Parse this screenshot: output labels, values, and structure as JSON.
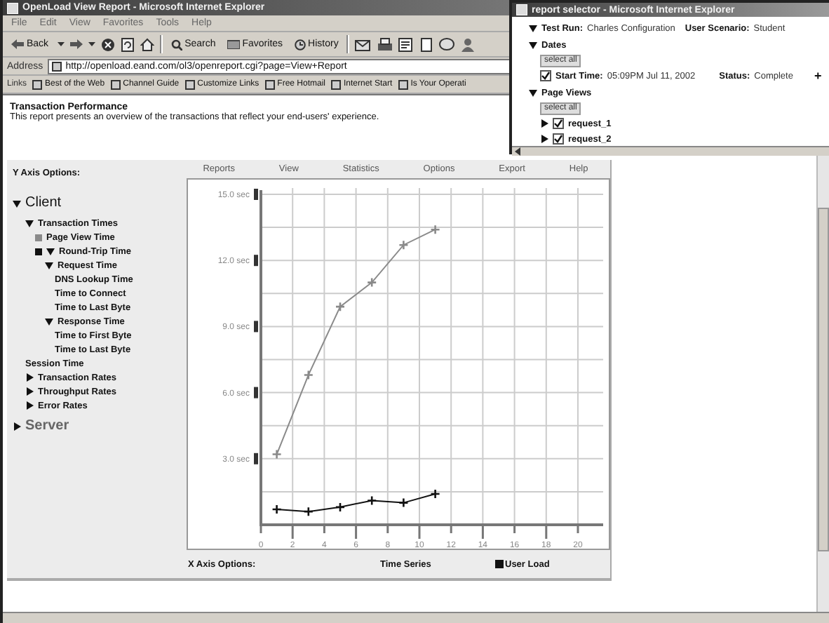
{
  "window": {
    "title": "OpenLoad View Report - Microsoft Internet Explorer"
  },
  "menu": [
    "File",
    "Edit",
    "View",
    "Favorites",
    "Tools",
    "Help"
  ],
  "toolbar": [
    {
      "label": "Back",
      "dropdown": true
    },
    {
      "label": "Search",
      "dropdown": false
    },
    {
      "label": "Favorites",
      "dropdown": false
    },
    {
      "label": "History",
      "dropdown": false
    }
  ],
  "address": {
    "label": "Address",
    "value": "http://openload.eand.com/ol3/openreport.cgi?page=View+Report"
  },
  "links": {
    "label": "Links",
    "items": [
      "Best of the Web",
      "Channel Guide",
      "Customize Links",
      "Free Hotmail",
      "Internet Start",
      "Is Your Operati"
    ]
  },
  "report": {
    "title": "Transaction Performance",
    "description": "This report presents an overview of the transactions that reflect your end-users' experience.",
    "y_axis_label": "Y Axis Options:",
    "nav": [
      "Reports",
      "View",
      "Statistics",
      "Options",
      "Export",
      "Help"
    ],
    "tree": [
      {
        "kind": "section",
        "label": "Client",
        "expanded": true,
        "children": [
          {
            "kind": "item",
            "label": "Transaction Times",
            "expanded": true,
            "children": [
              {
                "kind": "item",
                "label": "Page View Time",
                "color": "#8a8a8a"
              },
              {
                "kind": "item",
                "label": "Round-Trip Time",
                "color": "#111111",
                "expanded": true,
                "children": [
                  {
                    "kind": "item",
                    "label": "Request Time",
                    "expanded": true,
                    "children": [
                      {
                        "kind": "item",
                        "label": "DNS Lookup Time"
                      },
                      {
                        "kind": "item",
                        "label": "Time to Connect"
                      },
                      {
                        "kind": "item",
                        "label": "Time to Last Byte"
                      }
                    ]
                  },
                  {
                    "kind": "item",
                    "label": "Response Time",
                    "expanded": true,
                    "children": [
                      {
                        "kind": "item",
                        "label": "Time to First Byte"
                      },
                      {
                        "kind": "item",
                        "label": "Time to Last Byte"
                      }
                    ]
                  }
                ]
              }
            ]
          },
          {
            "kind": "item",
            "label": "Session Time"
          },
          {
            "kind": "item",
            "label": "Transaction Rates",
            "expanded": false
          },
          {
            "kind": "item",
            "label": "Throughput Rates",
            "expanded": false
          },
          {
            "kind": "item",
            "label": "Error Rates",
            "expanded": false
          }
        ]
      },
      {
        "kind": "section",
        "label": "Server",
        "expanded": false
      }
    ],
    "chart_data": {
      "type": "line",
      "x": [
        1,
        3,
        5,
        7,
        9,
        11
      ],
      "grid": true,
      "series": [
        {
          "color": "#8a8a8a",
          "marker": "cross",
          "values": [
            3.2,
            6.8,
            9.9,
            11.0,
            12.7,
            13.4
          ]
        },
        {
          "name": "User Load",
          "color": "#111111",
          "marker": "cross",
          "values": [
            0.7,
            0.6,
            0.8,
            1.1,
            1.0,
            1.4
          ]
        }
      ],
      "xlim": [
        0,
        20
      ],
      "ylim": [
        0,
        15
      ],
      "xticks": [
        0,
        2,
        4,
        6,
        8,
        10,
        12,
        14,
        16,
        18,
        20
      ],
      "yticks": [
        {
          "value": 3,
          "label": "3.0 sec"
        },
        {
          "value": 6,
          "label": "6.0 sec"
        },
        {
          "value": 9,
          "label": "9.0 sec"
        },
        {
          "value": 12,
          "label": "12.0 sec"
        },
        {
          "value": 15,
          "label": "15.0 sec"
        }
      ]
    },
    "x_axis_label": "X Axis Options:",
    "x_axis_value": "Time Series"
  },
  "selector": {
    "title": "report selector - Microsoft Internet Explorer",
    "test_run": {
      "label": "Test Run:",
      "value": "Charles Configuration"
    },
    "user_scenario": {
      "label": "User Scenario:",
      "value": "Student"
    },
    "groups": [
      {
        "label": "Dates",
        "expanded": true,
        "select_all": "select all",
        "items": [
          {
            "kind": "date",
            "checked": true,
            "label": "Start Time:",
            "value": "05:09PM Jul 11, 2002",
            "status_label": "Status:",
            "status": "Complete",
            "action": "+"
          }
        ]
      },
      {
        "label": "Page Views",
        "expanded": true,
        "select_all": "select all",
        "items": [
          {
            "kind": "request",
            "checked": true,
            "expanded": false,
            "label": "request_1"
          },
          {
            "kind": "request",
            "checked": true,
            "expanded": false,
            "label": "request_2"
          }
        ]
      }
    ]
  }
}
